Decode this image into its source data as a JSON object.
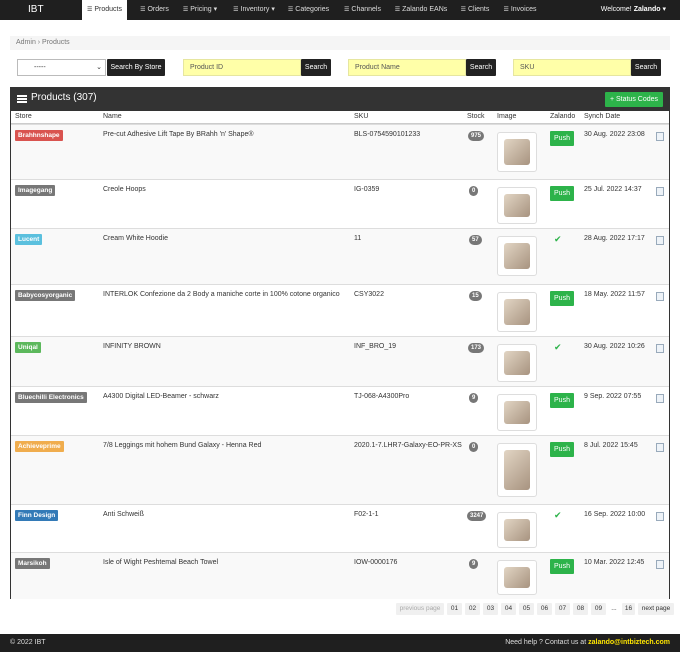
{
  "brand": "IBT",
  "nav": {
    "items": [
      {
        "label": "Products",
        "icon": "list-icon",
        "active": true
      },
      {
        "label": "Orders",
        "icon": "list-icon"
      },
      {
        "label": "Pricing",
        "icon": "list-icon",
        "caret": "▾"
      },
      {
        "label": "Inventory",
        "icon": "list-icon",
        "caret": "▾"
      },
      {
        "label": "Categories",
        "icon": "list-icon"
      },
      {
        "label": "Channels",
        "icon": "list-icon"
      },
      {
        "label": "Zalando EANs",
        "icon": "list-icon"
      },
      {
        "label": "Clients",
        "icon": "list-icon"
      },
      {
        "label": "Invoices",
        "icon": "list-icon"
      }
    ],
    "welcome_prefix": "Welcome!",
    "user": "Zalando",
    "user_caret": "▾"
  },
  "breadcrumb": "Admin › Products",
  "filters": {
    "store_select_value": "-----",
    "search_by_store_label": "Search By Store",
    "product_id_placeholder": "Product ID",
    "product_name_placeholder": "Product Name",
    "sku_placeholder": "SKU",
    "search_label": "Search"
  },
  "panel": {
    "title": "Products (307)",
    "status_codes_label": "+ Status Codes"
  },
  "columns": [
    "Store",
    "Name",
    "SKU",
    "Stock",
    "Image",
    "Zalando",
    "Synch Date"
  ],
  "rows": [
    {
      "store": "Brahhnshape",
      "store_color": "#d9534f",
      "name": "Pre-cut Adhesive Lift Tape By BRahh 'n' Shape®",
      "sku": "BLS-0754590101233",
      "stock": "975",
      "image": "tape-product-image",
      "zalando": "Push",
      "date": "30 Aug. 2022 23:08"
    },
    {
      "store": "Imagegang",
      "store_color": "#777777",
      "name": "Creole Hoops",
      "sku": "IG-0359",
      "stock": "0",
      "image": "hoop-earrings-image",
      "zalando": "Push",
      "date": "25 Jul. 2022 14:37"
    },
    {
      "store": "Lucent",
      "store_color": "#5bc0de",
      "name": "Cream White Hoodie",
      "sku": "11",
      "stock": "57",
      "image": "hoodie-image",
      "zalando": "✔",
      "date": "28 Aug. 2022 17:17"
    },
    {
      "store": "Babycosyorganic",
      "store_color": "#777777",
      "name": "INTERLOK Confezione da 2 Body a maniche corte in 100% cotone organico",
      "sku": "CSY3022",
      "stock": "15",
      "image": "baby-body-image",
      "zalando": "Push",
      "date": "18 May. 2022 11:57"
    },
    {
      "store": "Uniqal",
      "store_color": "#5cb85c",
      "name": "INFINITY BROWN",
      "sku": "INF_BRO_19",
      "stock": "173",
      "image": "bracelet-image",
      "zalando": "✔",
      "date": "30 Aug. 2022 10:26"
    },
    {
      "store": "Bluechilli Electronics",
      "store_color": "#777777",
      "name": "A4300 Digital LED-Beamer - schwarz",
      "sku": "TJ-068-A4300Pro",
      "stock": "9",
      "image": "projector-image",
      "zalando": "Push",
      "date": "9 Sep. 2022 07:55"
    },
    {
      "store": "Achieveprime",
      "store_color": "#f0ad4e",
      "name": "7/8 Leggings mit hohem Bund Galaxy - Henna Red",
      "sku": "2020.1-7.LHR7-Galaxy-EO-PR-XS",
      "stock": "0",
      "image": "leggings-image",
      "zalando": "Push",
      "date": "8 Jul. 2022 15:45"
    },
    {
      "store": "Finn Design",
      "store_color": "#337ab7",
      "name": "Anti Schweiß",
      "sku": "F02-1-1",
      "stock": "3247",
      "image": "undershirt-image",
      "zalando": "✔",
      "date": "16 Sep. 2022 10:00"
    },
    {
      "store": "Marsikoh",
      "store_color": "#777777",
      "name": "Isle of Wight Peshtemal Beach Towel",
      "sku": "IOW-0000176",
      "stock": "9",
      "image": "towel-image",
      "zalando": "Push",
      "date": "10 Mar. 2022 12:45"
    }
  ],
  "pagination": {
    "previous": "previous page",
    "pages": [
      "01",
      "02",
      "03",
      "04",
      "05",
      "06",
      "07",
      "08",
      "09",
      "...",
      "16"
    ],
    "next": "next page"
  },
  "footer": {
    "copyright": "© 2022 IBT",
    "help_text": "Need help ? Contact us at",
    "email": "zalando@intbiztech.com"
  }
}
